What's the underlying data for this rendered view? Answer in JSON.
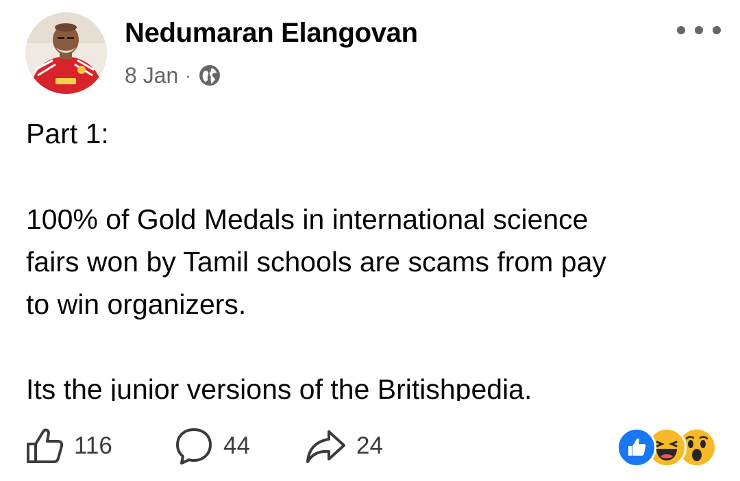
{
  "post": {
    "author": "Nedumaran Elangovan",
    "date": "8 Jan",
    "separator": "·",
    "privacy_icon": "globe-icon",
    "more_icon": "more-options-icon",
    "body_lines": [
      "Part 1:",
      "100% of Gold Medals in international science",
      "fairs won by Tamil schools are scams from pay",
      "to win organizers.",
      "Its the junior versions of the Britishpedia."
    ]
  },
  "footer": {
    "likes": "116",
    "comments": "44",
    "shares": "24",
    "reaction_icons": [
      "like-reaction-icon",
      "haha-reaction-icon",
      "wow-reaction-icon"
    ]
  },
  "colors": {
    "text": "#050505",
    "secondary_text": "#65676b",
    "like_blue": "#1877f2",
    "emoji_yellow": "#f7b928",
    "jersey_red": "#d8232a"
  }
}
